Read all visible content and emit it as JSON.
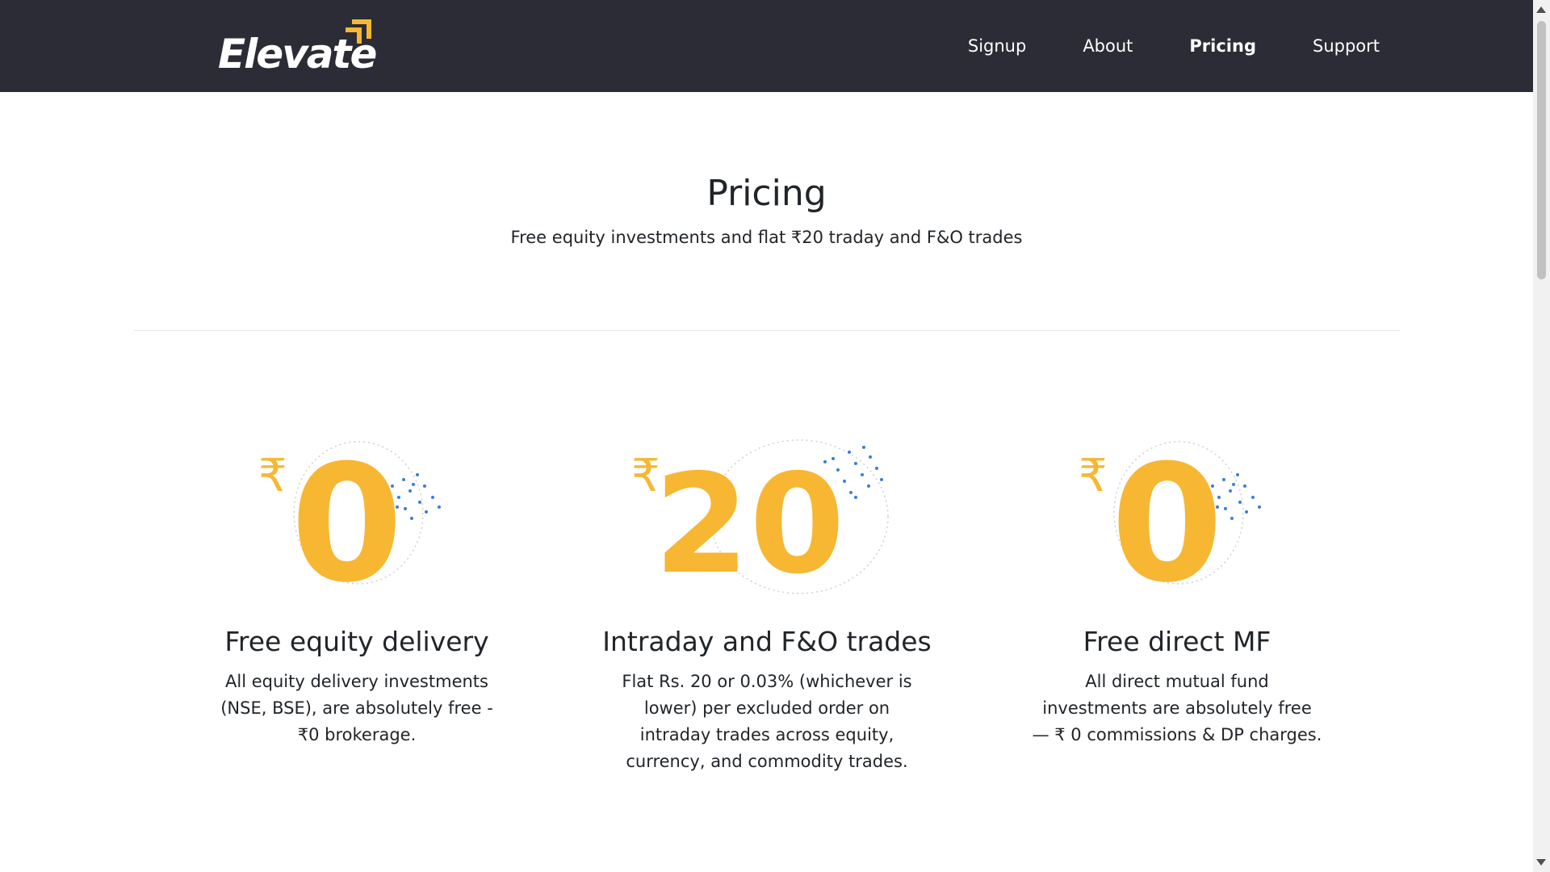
{
  "brand": {
    "name": "Elevate",
    "accent": "#f7b733",
    "navbar_bg": "#2b2c35"
  },
  "nav": {
    "items": [
      {
        "label": "Signup",
        "active": false
      },
      {
        "label": "About",
        "active": false
      },
      {
        "label": "Pricing",
        "active": true
      },
      {
        "label": "Support",
        "active": false
      }
    ]
  },
  "hero": {
    "title": "Pricing",
    "subtitle": "Free equity investments and flat ₹20 traday and F&O trades"
  },
  "cards": [
    {
      "currency": "₹",
      "amount": "0",
      "title": "Free equity delivery",
      "description": "All equity delivery investments (NSE, BSE), are absolutely free - ₹0 brokerage."
    },
    {
      "currency": "₹",
      "amount": "20",
      "title": "Intraday and F&O trades",
      "description": "Flat Rs. 20 or 0.03% (whichever is lower) per excluded order on intraday trades across equity, currency, and commodity trades."
    },
    {
      "currency": "₹",
      "amount": "0",
      "title": "Free direct MF",
      "description": "All direct mutual fund investments are absolutely free — ₹ 0 commissions & DP charges."
    }
  ],
  "icons": {
    "logo_mark": "chevron-arrow-icon",
    "dots": "decorative-dots-icon"
  }
}
